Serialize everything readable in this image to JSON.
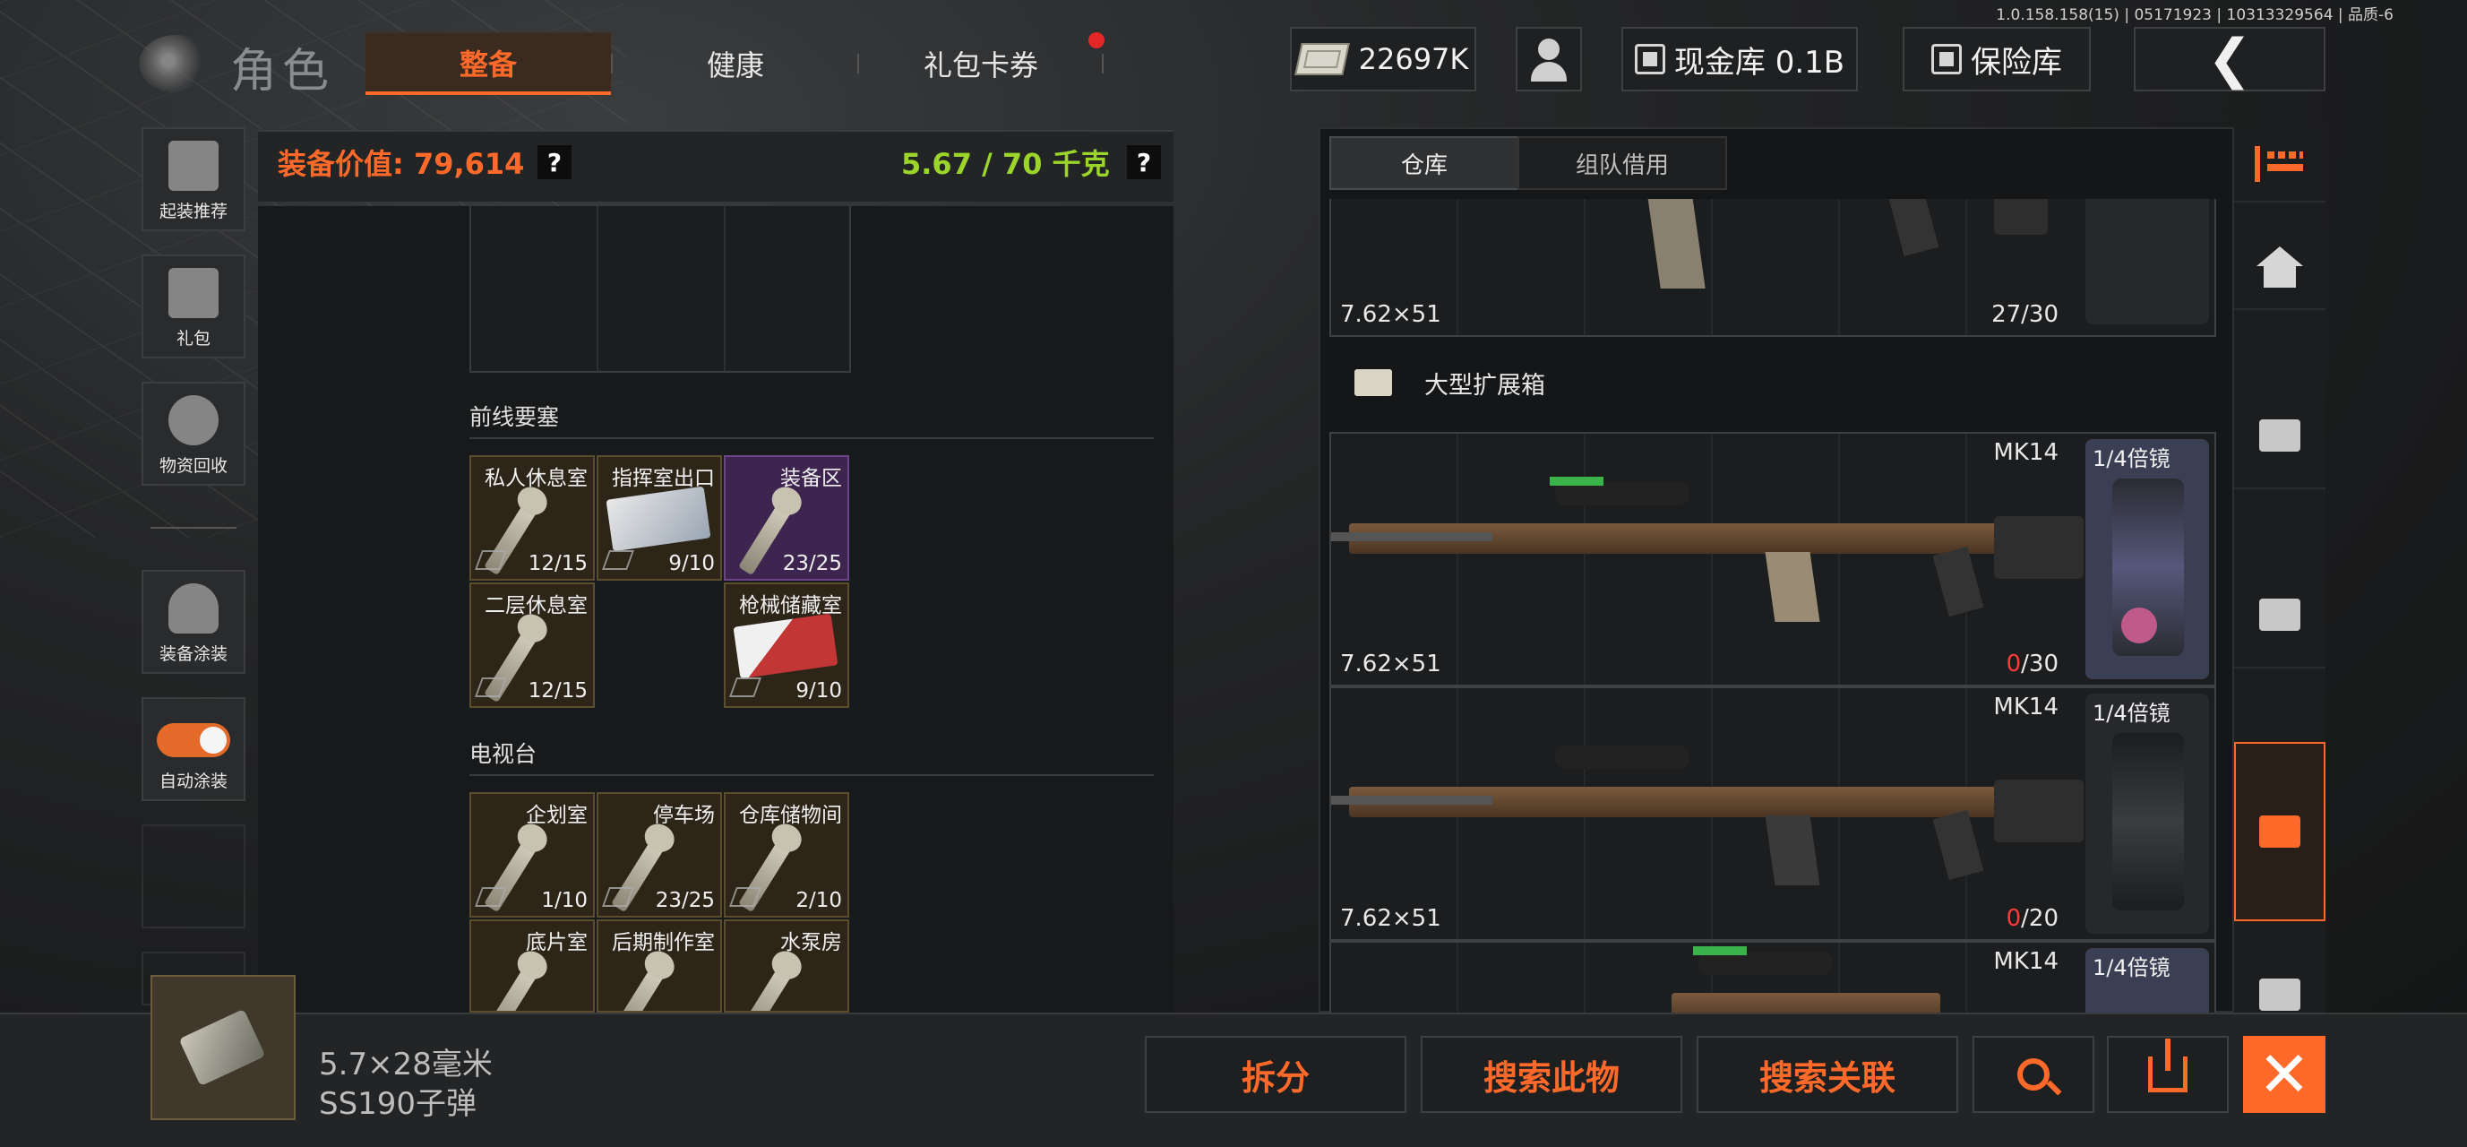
{
  "version": "1.0.158.158(15) | 05171923 | 10313329564 | 品质-6",
  "header": {
    "role_title": "角色",
    "tabs": [
      {
        "label": "整备",
        "active": true
      },
      {
        "label": "健康",
        "active": false
      },
      {
        "label": "礼包卡券",
        "active": false,
        "notification": true
      }
    ],
    "currency": "22697K",
    "cash_vault": "现金库 0.1B",
    "safe_vault": "保险库",
    "back_icon": "chevron-left-icon"
  },
  "sidebar": {
    "items": [
      {
        "label": "起装推荐",
        "icon": "loadout-icon"
      },
      {
        "label": "礼包",
        "icon": "gift-icon"
      },
      {
        "label": "物资回收",
        "icon": "recycle-icon"
      },
      {
        "label": "装备涂装",
        "icon": "helmet-icon"
      },
      {
        "label": "自动涂装",
        "icon": "toggle-icon",
        "toggle_on": true
      }
    ]
  },
  "equipment": {
    "value_label": "装备价值: 79,614",
    "weight_label": "5.67 / 70 千克",
    "help_glyph": "?",
    "sections": [
      {
        "title": "前线要塞",
        "slots": [
          {
            "name": "私人休息室",
            "count": "12/15",
            "kind": "key"
          },
          {
            "name": "指挥室出口",
            "count": "9/10",
            "kind": "card"
          },
          {
            "name": "装备区",
            "count": "23/25",
            "kind": "key",
            "rarity": "purple"
          },
          {
            "name": "二层休息室",
            "count": "12/15",
            "kind": "key"
          },
          {
            "name": "",
            "count": "",
            "kind": "blank"
          },
          {
            "name": "枪械储藏室",
            "count": "9/10",
            "kind": "card-red"
          }
        ]
      },
      {
        "title": "电视台",
        "slots": [
          {
            "name": "企划室",
            "count": "1/10",
            "kind": "key"
          },
          {
            "name": "停车场",
            "count": "23/25",
            "kind": "key"
          },
          {
            "name": "仓库储物间",
            "count": "2/10",
            "kind": "key"
          },
          {
            "name": "底片室",
            "count": "",
            "kind": "key"
          },
          {
            "name": "后期制作室",
            "count": "",
            "kind": "key"
          },
          {
            "name": "水泵房",
            "count": "",
            "kind": "key"
          }
        ]
      }
    ]
  },
  "selected_item": {
    "line1": "5.7×28毫米",
    "line2": "SS190子弹"
  },
  "actions": {
    "split": "拆分",
    "search_item": "搜索此物",
    "search_related": "搜索关联",
    "search_icon": "search-icon",
    "upload_icon": "upload-icon",
    "close_icon": "close-icon"
  },
  "warehouse": {
    "tabs": [
      "仓库",
      "组队借用"
    ],
    "top_item": {
      "ammo": "7.62×51",
      "count": "27/30"
    },
    "box_label": "大型扩展箱",
    "weapons": [
      {
        "name": "MK14",
        "ammo": "7.62×51",
        "count_zero": "0",
        "count_rest": "/30",
        "scope": "1/4倍镜"
      },
      {
        "name": "MK14",
        "ammo": "7.62×51",
        "count_zero": "0",
        "count_rest": "/20",
        "scope": "1/4倍镜"
      },
      {
        "name": "MK14",
        "ammo": "",
        "count_zero": "",
        "count_rest": "",
        "scope": "1/4倍镜"
      }
    ]
  },
  "colors": {
    "accent": "#ff6a2a",
    "weight_green": "#9bd42a",
    "alert_red": "#e42626"
  }
}
